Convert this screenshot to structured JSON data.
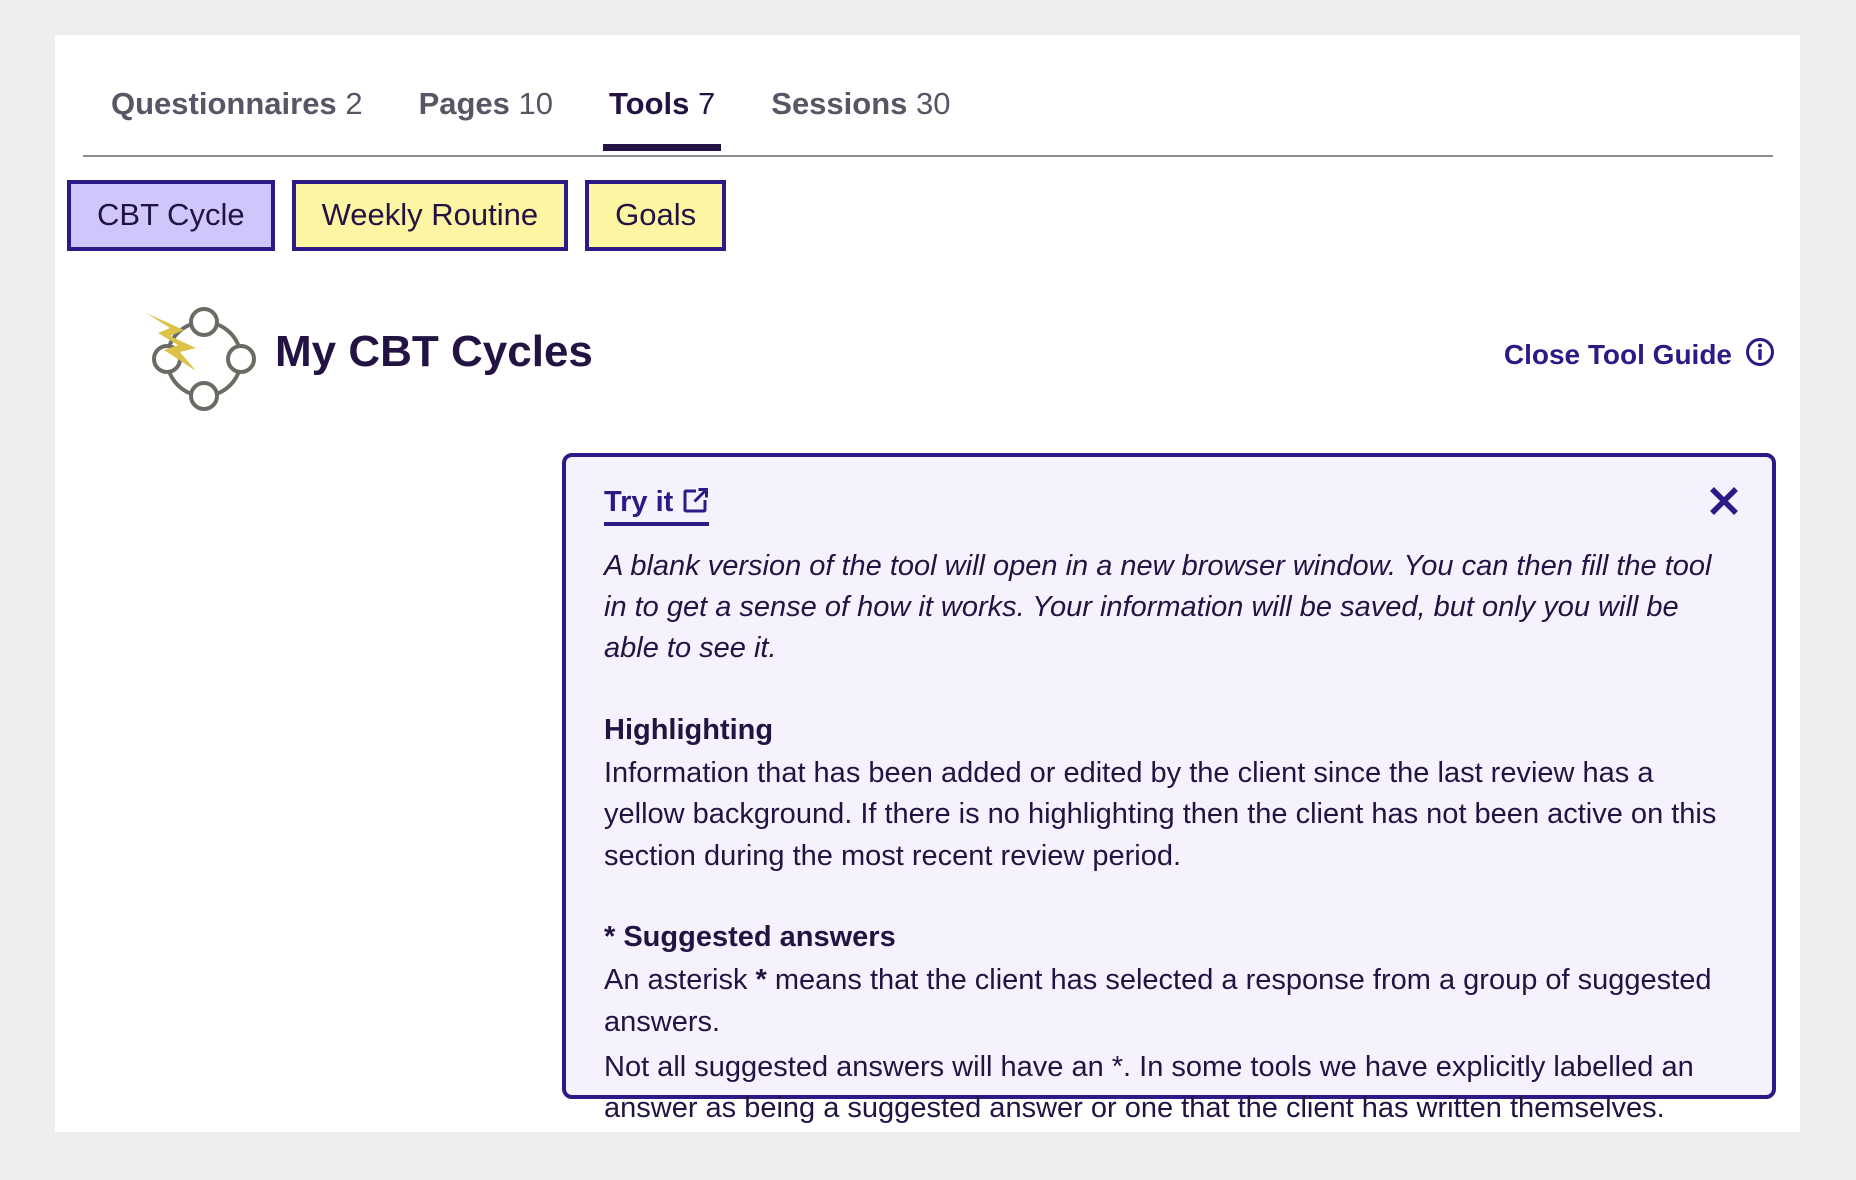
{
  "tabs": [
    {
      "label": "Questionnaires",
      "count": "2",
      "active": false,
      "name": "tab-questionnaires"
    },
    {
      "label": "Pages",
      "count": "10",
      "active": false,
      "name": "tab-pages"
    },
    {
      "label": "Tools",
      "count": "7",
      "active": true,
      "name": "tab-tools"
    },
    {
      "label": "Sessions",
      "count": "30",
      "active": false,
      "name": "tab-sessions"
    }
  ],
  "chips": [
    {
      "label": "CBT Cycle",
      "style": "lilac"
    },
    {
      "label": "Weekly Routine",
      "style": "yellow"
    },
    {
      "label": "Goals",
      "style": "yellow"
    }
  ],
  "title": {
    "heading": "My CBT Cycles",
    "icon": "cbt-cycle-icon"
  },
  "close_guide": {
    "label": "Close Tool Guide",
    "icon": "info-icon"
  },
  "guide": {
    "try_it_label": "Try it",
    "try_it_icon": "external-link-icon",
    "close_icon": "close-icon",
    "intro": "A blank version of the tool will open in a new browser window. You can then fill the tool in to get a sense of how it works. Your information will be saved, but only you will be able to see it.",
    "highlighting_heading": "Highlighting",
    "highlighting_body": "Information that has been added or edited by the client since the last review has a yellow background. If there is no highlighting then the client has not been active on this section during the most recent review period.",
    "suggested_heading": "* Suggested answers",
    "suggested_body_1_pre": "An asterisk ",
    "suggested_body_1_bold": "*",
    "suggested_body_1_post": " means that the client has selected a response from a group of suggested answers.",
    "suggested_body_2": "Not all suggested answers will have an *. In some tools we have explicitly labelled an answer as being a suggested answer or one that the client has written themselves."
  },
  "colors": {
    "accent": "#2e1a87",
    "heading": "#231342",
    "chip_yellow": "#fcf5a2",
    "chip_lilac": "#cfc6fb",
    "panel_bg": "#f5f2fd",
    "page_bg": "#efeeee",
    "inactive_tab": "#5a5566",
    "bolt": "#ddc249",
    "cycle_stroke": "#6b6b63"
  }
}
